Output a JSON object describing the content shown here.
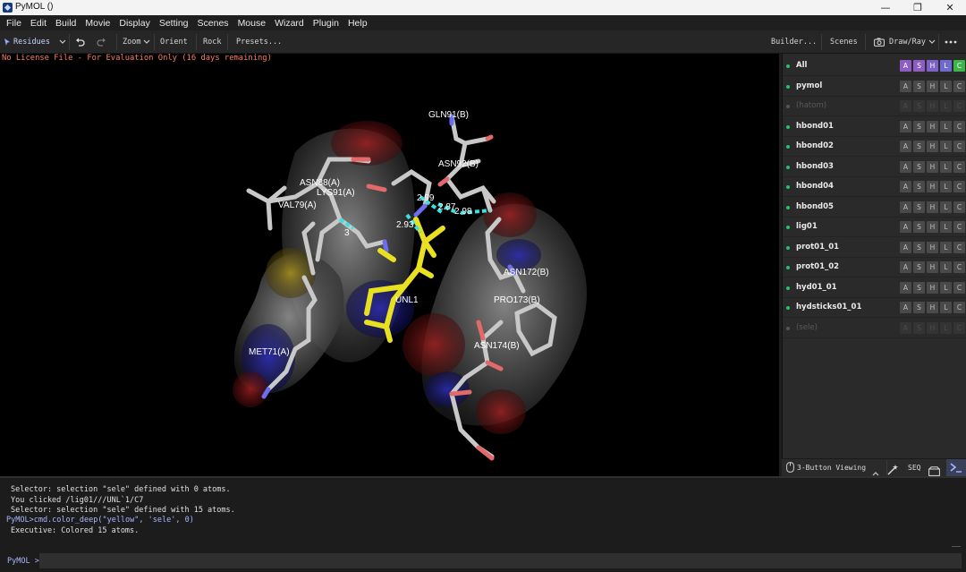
{
  "window": {
    "title": "PyMOL ()",
    "minimize_glyph": "—",
    "restore_glyph": "❐",
    "close_glyph": "✕"
  },
  "menu": [
    "File",
    "Edit",
    "Build",
    "Movie",
    "Display",
    "Setting",
    "Scenes",
    "Mouse",
    "Wizard",
    "Plugin",
    "Help"
  ],
  "toolbar": {
    "selection_mode": "Residues",
    "zoom": "Zoom",
    "orient": "Orient",
    "rock": "Rock",
    "presets": "Presets...",
    "builder": "Builder...",
    "scenes": "Scenes",
    "draw_ray": "Draw/Ray"
  },
  "viewport": {
    "license_notice": "No License File - For Evaluation Only (16 days remaining)",
    "residue_labels": {
      "gln91": "GLN91(B)",
      "asn92": "ASN92(B)",
      "asn88": "ASN88(A)",
      "lys91": "LYS91(A)",
      "val79": "VAL79(A)",
      "asn172": "ASN172(B)",
      "pro173": "PRO173(B)",
      "asn174": "ASN174(B)",
      "met71": "MET71(A)",
      "unl1": "UNL1"
    },
    "distances": {
      "d1": "2.99",
      "d2": "2.87",
      "d3": "2.98",
      "d4": "2.93",
      "d5": "3"
    }
  },
  "objects": [
    {
      "name": "All",
      "enabled": true
    },
    {
      "name": "pymol",
      "enabled": true
    },
    {
      "name": "(hatom)",
      "enabled": false
    },
    {
      "name": "hbond01",
      "enabled": true
    },
    {
      "name": "hbond02",
      "enabled": true
    },
    {
      "name": "hbond03",
      "enabled": true
    },
    {
      "name": "hbond04",
      "enabled": true
    },
    {
      "name": "hbond05",
      "enabled": true
    },
    {
      "name": "lig01",
      "enabled": true
    },
    {
      "name": "prot01_01",
      "enabled": true
    },
    {
      "name": "prot01_02",
      "enabled": true
    },
    {
      "name": "hyd01_01",
      "enabled": true
    },
    {
      "name": "hydsticks01_01",
      "enabled": true
    },
    {
      "name": "(sele)",
      "enabled": false
    }
  ],
  "object_buttons": [
    "A",
    "S",
    "H",
    "L",
    "C"
  ],
  "all_button_colors": [
    "#8e5cc5",
    "#8e5cc5",
    "#7b61c8",
    "#6f6ad0",
    "#3db54a"
  ],
  "bottom_bar": {
    "mouse_mode": "3-Button Viewing",
    "seq": "SEQ"
  },
  "console": {
    "lines": [
      {
        "text": "Selector: selection \"sele\" defined with 0 atoms.",
        "cmd": false
      },
      {
        "text": "You clicked /lig01///UNL`1/C7",
        "cmd": false
      },
      {
        "text": "Selector: selection \"sele\" defined with 15 atoms.",
        "cmd": false
      },
      {
        "text": "PyMOL>cmd.color_deep(\"yellow\", 'sele', 0)",
        "cmd": true
      },
      {
        "text": "Executive: Colored 15 atoms.",
        "cmd": false
      }
    ],
    "prompt": "PyMOL",
    "prompt_arrow": ">",
    "input_value": ""
  }
}
